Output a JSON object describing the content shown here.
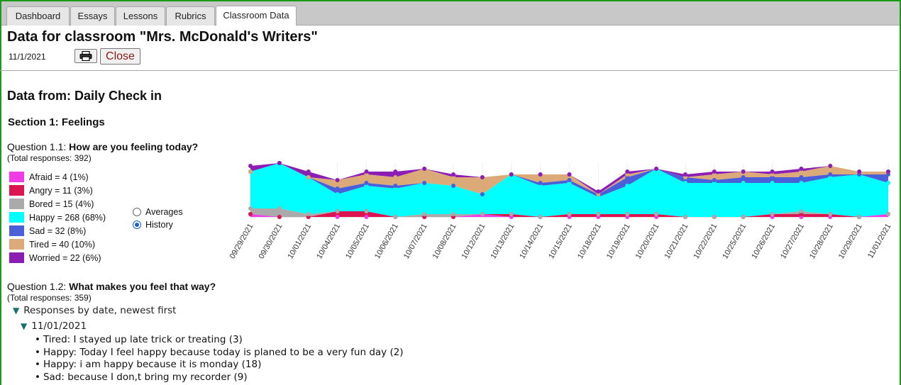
{
  "tabs": [
    {
      "label": "Dashboard",
      "active": false
    },
    {
      "label": "Essays",
      "active": false
    },
    {
      "label": "Lessons",
      "active": false
    },
    {
      "label": "Rubrics",
      "active": false
    },
    {
      "label": "Classroom Data",
      "active": true
    }
  ],
  "page": {
    "title": "Data for classroom \"Mrs. McDonald's Writers\"",
    "date": "11/1/2021",
    "close_label": "Close",
    "data_from": "Data from: Daily Check in",
    "section": "Section 1: Feelings"
  },
  "q1": {
    "prefix": "Question 1.1: ",
    "text": "How are you feeling today?",
    "total": "(Total responses: 392)"
  },
  "legend": [
    {
      "label": "Afraid = 4 (1%)",
      "color": "#f03ce6"
    },
    {
      "label": "Angry = 11 (3%)",
      "color": "#dc1450"
    },
    {
      "label": "Bored = 15 (4%)",
      "color": "#aaaaaa"
    },
    {
      "label": "Happy = 268 (68%)",
      "color": "#00ffff"
    },
    {
      "label": "Sad = 32 (8%)",
      "color": "#4a5fd8"
    },
    {
      "label": "Tired = 40 (10%)",
      "color": "#dcaa78"
    },
    {
      "label": "Worried = 22 (6%)",
      "color": "#8c1eb4"
    }
  ],
  "view_options": {
    "averages": "Averages",
    "history": "History",
    "selected": "history"
  },
  "chart_data": {
    "type": "area",
    "stacked": true,
    "x": [
      "09/29/2021",
      "09/30/2021",
      "10/01/2021",
      "10/04/2021",
      "10/05/2021",
      "10/06/2021",
      "10/07/2021",
      "10/08/2021",
      "10/12/2021",
      "10/13/2021",
      "10/14/2021",
      "10/15/2021",
      "10/18/2021",
      "10/19/2021",
      "10/20/2021",
      "10/21/2021",
      "10/22/2021",
      "10/25/2021",
      "10/26/2021",
      "10/27/2021",
      "10/28/2021",
      "10/29/2021",
      "11/01/2021"
    ],
    "series": [
      {
        "name": "Afraid",
        "color": "#f03ce6",
        "values": [
          1,
          0,
          0,
          0,
          0,
          0,
          0,
          0,
          1,
          0,
          0,
          0,
          0,
          0,
          0,
          0,
          0,
          0,
          0,
          0,
          0,
          0,
          1
        ]
      },
      {
        "name": "Angry",
        "color": "#dc1450",
        "values": [
          0,
          0,
          0,
          2,
          2,
          0,
          0,
          0,
          0,
          1,
          0,
          1,
          1,
          1,
          1,
          0,
          0,
          0,
          1,
          1,
          1,
          0,
          0
        ]
      },
      {
        "name": "Bored",
        "color": "#aaaaaa",
        "values": [
          2,
          3,
          1,
          0,
          0,
          0,
          1,
          1,
          0,
          0,
          0,
          0,
          0,
          0,
          0,
          0,
          0,
          0,
          0,
          1,
          0,
          0,
          0
        ]
      },
      {
        "name": "Happy",
        "color": "#00ffff",
        "values": [
          13,
          16,
          13,
          6,
          9,
          10,
          11,
          10,
          7,
          14,
          11,
          11,
          6,
          10,
          16,
          12,
          12,
          12,
          11,
          10,
          13,
          15,
          11
        ]
      },
      {
        "name": "Sad",
        "color": "#4a5fd8",
        "values": [
          0,
          0,
          0,
          2,
          1,
          1,
          0,
          0,
          0,
          0,
          1,
          1,
          1,
          3,
          0,
          2,
          1,
          2,
          2,
          2,
          1,
          0,
          3
        ]
      },
      {
        "name": "Tired",
        "color": "#dcaa78",
        "values": [
          0,
          0,
          0,
          3,
          3,
          3,
          5,
          3,
          6,
          0,
          3,
          2,
          0,
          1,
          0,
          0,
          2,
          2,
          1,
          2,
          3,
          1,
          1
        ]
      },
      {
        "name": "Worried",
        "color": "#8c1eb4",
        "values": [
          2,
          0,
          2,
          0,
          1,
          2,
          0,
          1,
          0,
          0,
          0,
          0,
          1,
          1,
          0,
          1,
          1,
          0,
          1,
          1,
          0,
          0,
          0
        ]
      }
    ],
    "grid": false,
    "legend": "left"
  },
  "q2": {
    "prefix": "Question 1.2: ",
    "text": "What makes you feel that way?",
    "total": "(Total responses: 359)"
  },
  "responses": {
    "header": "Responses by date, newest first",
    "date": "11/01/2021",
    "items": [
      "Tired: I stayed up late trick or treating (3)",
      "Happy: Today I feel happy because today is planed to be a very fun day (2)",
      "Happy: i am happy because it is monday (18)",
      "Sad: because I don,t bring my recorder (9)"
    ]
  }
}
